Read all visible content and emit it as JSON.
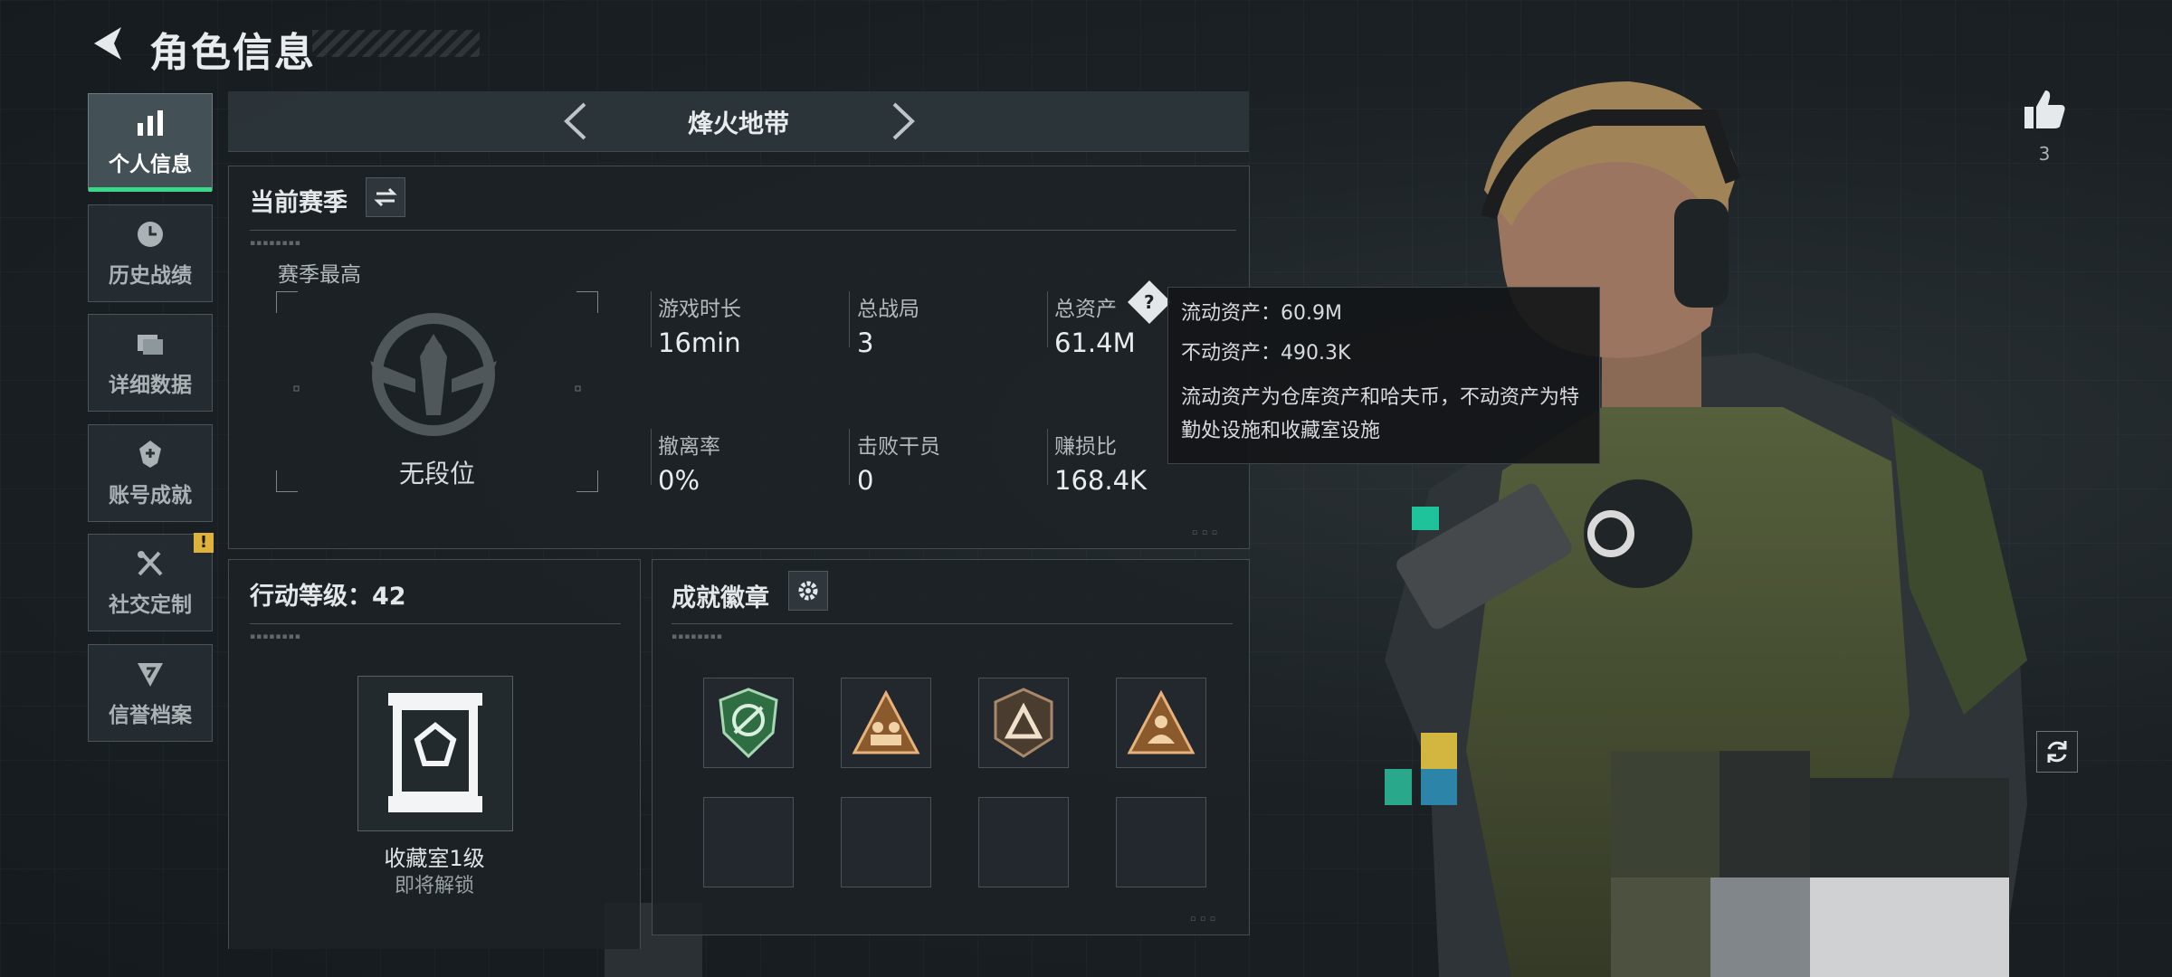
{
  "header": {
    "title": "角色信息"
  },
  "nav": [
    {
      "label": "个人信息",
      "icon": "bar-chart-icon",
      "active": true
    },
    {
      "label": "历史战绩",
      "icon": "history-icon",
      "active": false
    },
    {
      "label": "详细数据",
      "icon": "folder-icon",
      "active": false
    },
    {
      "label": "账号成就",
      "icon": "achievement-icon",
      "active": false
    },
    {
      "label": "社交定制",
      "icon": "tools-icon",
      "active": false,
      "badge": "!"
    },
    {
      "label": "信誉档案",
      "icon": "reputation-icon",
      "active": false
    }
  ],
  "mode": {
    "title": "烽火地带"
  },
  "season": {
    "title": "当前赛季",
    "best_label": "赛季最高",
    "rank": "无段位",
    "stats": [
      {
        "label": "游戏时长",
        "value": "16min"
      },
      {
        "label": "总战局",
        "value": "3"
      },
      {
        "label": "总资产",
        "value": "61.4M"
      },
      {
        "label": "撤离率",
        "value": "0%"
      },
      {
        "label": "击败干员",
        "value": "0"
      },
      {
        "label": "赚损比",
        "value": "168.4K"
      }
    ]
  },
  "tooltip": {
    "liquid": "流动资产：60.9M",
    "fixed": "不动资产：490.3K",
    "desc": "流动资产为仓库资产和哈夫币，不动资产为特勤处设施和收藏室设施"
  },
  "level": {
    "title": "行动等级：42",
    "vault_name": "收藏室1级",
    "vault_status": "即将解锁"
  },
  "badges": {
    "title": "成就徽章"
  },
  "likes": {
    "count": "3"
  },
  "colors": {
    "accent": "#39d98a",
    "warn": "#e0b23c",
    "medal_gold": "#c9945a",
    "medal_green": "#3fa060"
  }
}
